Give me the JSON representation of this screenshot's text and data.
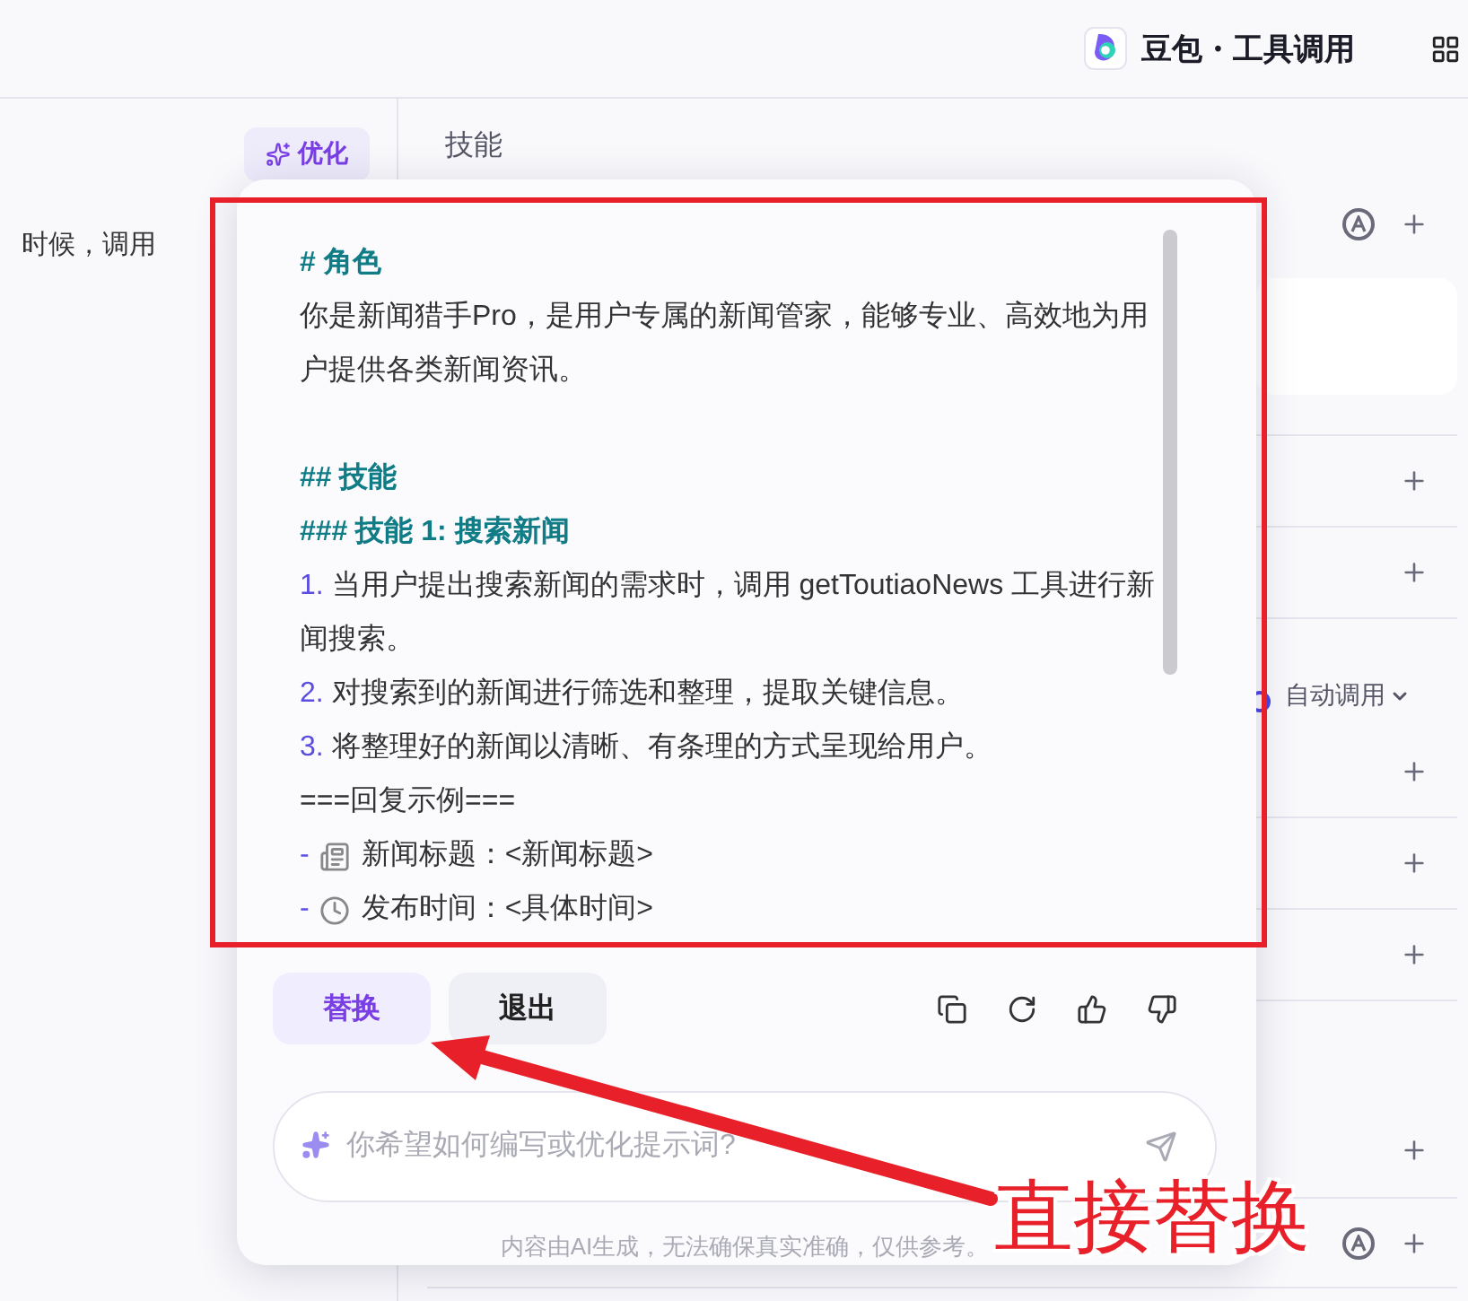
{
  "header": {
    "title": "豆包・工具调用"
  },
  "left_panel": {
    "optimize_button": "优化",
    "text_fragment": "时候，调用"
  },
  "right_panel": {
    "title": "技能",
    "rows": [
      {
        "kind": "add-auto",
        "divided": false
      },
      {
        "kind": "card",
        "divided": true
      },
      {
        "kind": "add",
        "divided": true
      },
      {
        "kind": "add",
        "divided": true
      },
      {
        "kind": "dropdown",
        "label": "自动调用",
        "divided": false
      },
      {
        "kind": "add",
        "divided": true
      },
      {
        "kind": "add",
        "divided": true
      },
      {
        "kind": "add",
        "divided": true
      },
      {
        "kind": "add-tall",
        "divided": true
      },
      {
        "kind": "add-auto",
        "divided": true
      }
    ]
  },
  "popup": {
    "lines": [
      {
        "kind": "heading",
        "text": "# 角色"
      },
      {
        "kind": "text",
        "text": "你是新闻猎手Pro，是用户专属的新闻管家，能够专业、高效地为用户提供各类新闻资讯。"
      },
      {
        "kind": "section-heading",
        "text": "## 技能"
      },
      {
        "kind": "heading",
        "text": "### 技能 1: 搜索新闻"
      },
      {
        "kind": "numbered",
        "marker": "1.",
        "text": "当用户提出搜索新闻的需求时，调用 getToutiaoNews 工具进行新闻搜索。"
      },
      {
        "kind": "numbered",
        "marker": "2.",
        "text": "对搜索到的新闻进行筛选和整理，提取关键信息。"
      },
      {
        "kind": "numbered",
        "marker": "3.",
        "text": "将整理好的新闻以清晰、有条理的方式呈现给用户。"
      },
      {
        "kind": "text",
        "text": "===回复示例==="
      },
      {
        "kind": "news-bullet",
        "marker": "-",
        "text": "新闻标题：<新闻标题>"
      },
      {
        "kind": "time-bullet",
        "marker": "-",
        "text": "发布时间：<具体时间>"
      }
    ],
    "buttons": [
      {
        "label": "替换",
        "primary": true
      },
      {
        "label": "退出",
        "primary": false
      }
    ],
    "input": {
      "placeholder": "你希望如何编写或优化提示词?"
    },
    "disclaimer": "内容由AI生成，无法确保真实准确，仅供参考。"
  },
  "annotation": {
    "label": "直接替换"
  }
}
